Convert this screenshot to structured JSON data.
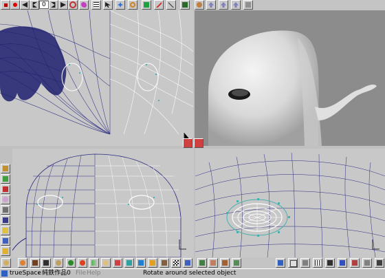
{
  "top_toolbar": {
    "counter_value": "0",
    "icons": [
      "stop-icon",
      "record-icon",
      "rewind-icon",
      "step-back-icon",
      "frame-counter",
      "step-forward-icon",
      "play-icon",
      "loop-icon",
      "bird-icon",
      "keyframe-list-icon",
      "select-arrow-icon",
      "move-icon",
      "rotate-icon",
      "scale-icon",
      "material-icon",
      "object-icon",
      "render-icon",
      "teapot-icon",
      "undo-icon",
      "redo-icon",
      "back-icon",
      "zoom-icon"
    ]
  },
  "left_toolbar": {
    "icons": [
      "primitives-icon",
      "deform-icon",
      "paint-icon",
      "material-ball-icon",
      "texture-icon",
      "camera-icon",
      "light-icon",
      "group-icon",
      "cursor-icon"
    ]
  },
  "bottom_library": {
    "icons": [
      "sphere-material-icon",
      "orange-ball-icon",
      "film-icon",
      "bones-icon",
      "spheres-icon",
      "half-sphere-icon",
      "seed-icon",
      "gradient-icon",
      "pie-icon",
      "ribbon-icon",
      "flower-icon",
      "teapot-lib-icon",
      "checker-icon",
      "cube-icon",
      "plant-icon",
      "face-icon",
      "figure-icon",
      "grid-a-icon",
      "grid-b-icon",
      "sun-icon",
      "wand-icon",
      "wave-icon",
      "bird-lib-icon"
    ]
  },
  "status_bar": {
    "app_name": "trueSpace",
    "app_title_suffix": "- 純鉄作品0",
    "menu_file": "File",
    "menu_help": "Help",
    "message": "Rotate around selected object"
  },
  "viewports": [
    "viewport-top-left-wireframe",
    "viewport-top-right-shaded",
    "viewport-bottom-left-front",
    "viewport-bottom-right-closeup"
  ],
  "colors": {
    "viewport_grey": "#c8c8c8",
    "wire_blue": "#2a2a80",
    "shaded_bg": "#8c8c8c",
    "teal_points": "#49b0b0"
  }
}
